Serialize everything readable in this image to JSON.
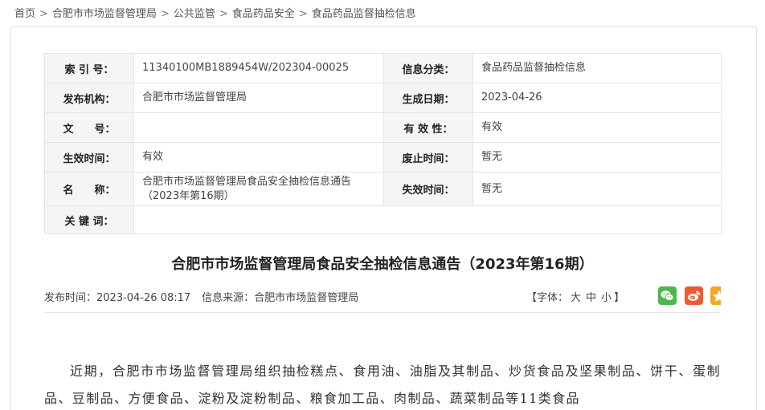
{
  "breadcrumb": [
    "首页",
    "合肥市市场监督管理局",
    "公共监管",
    "食品药品安全",
    "食品药品监督抽检信息"
  ],
  "meta": {
    "index_label": "索 引 号：",
    "index_value": "11340100MB1889454W/202304-00025",
    "category_label": "信息分类：",
    "category_value": "食品药品监督抽检信息",
    "org_label": "发布机构：",
    "org_value": "合肥市市场监督管理局",
    "date_label": "生成日期：",
    "date_value": "2023-04-26",
    "docno_label": "文　　号：",
    "docno_value": "",
    "validity_label": "有 效 性：",
    "validity_value": "有效",
    "effective_label": "生效时间：",
    "effective_value": "有效",
    "repeal_label": "废止时间：",
    "repeal_value": "暂无",
    "name_label": "名　　称：",
    "name_value": "合肥市市场监督管理局食品安全抽检信息通告（2023年第16期）",
    "expire_label": "失效时间：",
    "expire_value": "暂无",
    "keywords_label": "关 键 词：",
    "keywords_value": ""
  },
  "article": {
    "title": "合肥市市场监督管理局食品安全抽检信息通告（2023年第16期）",
    "publish_label": "发布时间：",
    "publish_time": "2023-04-26 08:17",
    "source_label": "信息来源：",
    "source_value": "合肥市市场监督管理局",
    "font_prefix": "【字体：",
    "font_large": "大",
    "font_medium": "中",
    "font_small": "小",
    "font_suffix": "】",
    "body": "近期，合肥市市场监督管理局组织抽检糕点、食用油、油脂及其制品、炒货食品及坚果制品、饼干、蛋制品、豆制品、方便食品、淀粉及淀粉制品、粮食加工品、肉制品、蔬菜制品等11类食品"
  },
  "icons": {
    "wechat": "wechat-icon",
    "weibo": "weibo-icon",
    "qzone": "qzone-icon"
  },
  "colors": {
    "wechat": "#4cb848",
    "weibo": "#ee5a32",
    "qzone": "#f5a623"
  }
}
